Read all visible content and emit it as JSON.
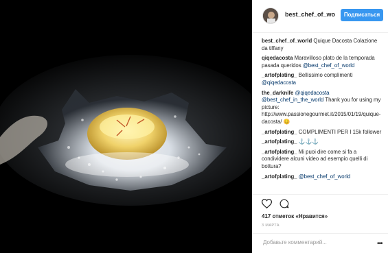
{
  "header": {
    "username": "best_chef_of_world",
    "follow_label": "Подписаться"
  },
  "caption": {
    "username": "best_chef_of_world",
    "text": "Quique Dacosta Colazione da tiffany"
  },
  "comments": [
    {
      "username": "qiqedacosta",
      "text": "Maravilloso plato de la temporada pasada queridos ",
      "mention": "@best_chef_of_world",
      "after": ""
    },
    {
      "username": "_artofplating_",
      "text": "Bellissimo complimenti ",
      "mention": "@qiqedacosta",
      "after": ""
    },
    {
      "username": "the_darknife",
      "text": "",
      "mention": "@qiqedacosta @best_chef_in_the_world",
      "after": " Thank you for using my picture: http://www.passionegourmet.it/2015/01/19/quique-dacosta/ 😊"
    },
    {
      "username": "_artofplating_",
      "text": "COMPLIMENTI PER I 15k follower",
      "mention": "",
      "after": ""
    },
    {
      "username": "_artofplating_",
      "text": "⚓⚓⚓",
      "mention": "",
      "after": ""
    },
    {
      "username": "_artofplating_",
      "text": "Mi puoi dire come si fa a condividere alcuni video ad esempio quelli di bottura?",
      "mention": "",
      "after": ""
    },
    {
      "username": "_artofplating_",
      "text": "",
      "mention": "@best_chef_of_world",
      "after": ""
    }
  ],
  "likes": "417 отметок «Нравится»",
  "date": "3 МАРТА",
  "add_comment": {
    "placeholder": "Добавьте комментарий..."
  },
  "icons": {
    "like": "heart-icon",
    "comment": "comment-icon",
    "more": "more-options-icon"
  },
  "colors": {
    "follow_button": "#3897f0",
    "mention": "#003569"
  }
}
